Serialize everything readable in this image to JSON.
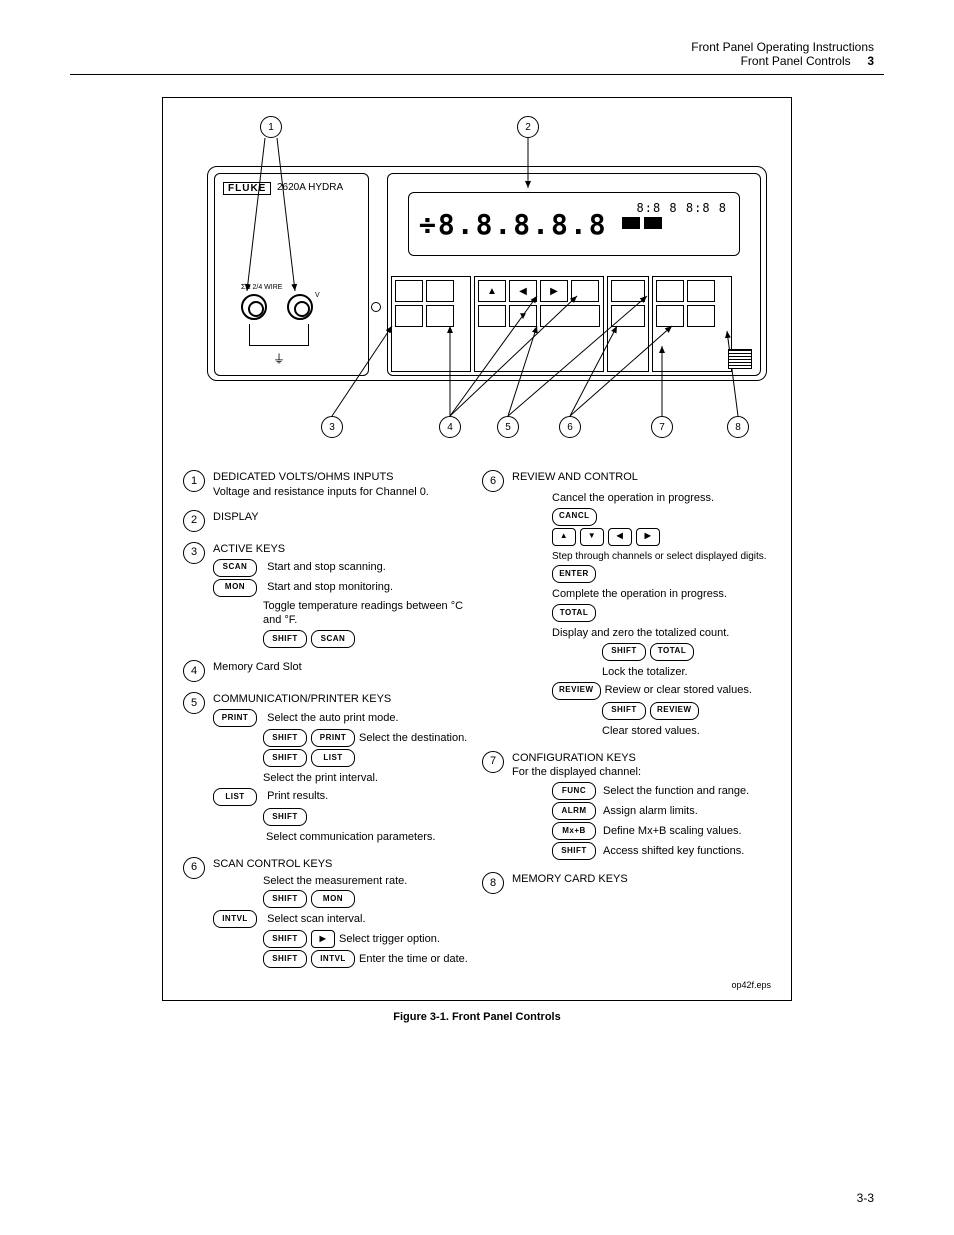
{
  "header": {
    "left": "",
    "right1": "Front Panel Operating Instructions",
    "right2": "Front Panel Controls",
    "chapter": "3"
  },
  "device": {
    "brand": "FLUKE",
    "model": "2620A  HYDRA",
    "sigma": "ΣΩ 2/4 WIRE",
    "vlabel": "V",
    "lcd_main": "÷8.8.8.8.8",
    "lcd_bars": true,
    "lcd_aux": "",
    "lcd_right": "8:8 8 8:8 8"
  },
  "bubbles": {
    "b1": "1",
    "b2": "2",
    "b3": "3",
    "b4": "4",
    "b5": "5",
    "b6": "6",
    "b7": "7",
    "b8": "8"
  },
  "legend": {
    "entries": {
      "1": {
        "title": "DEDICATED VOLTS/OHMS INPUTS",
        "sub": "Voltage and resistance inputs for Channel 0."
      },
      "2": {
        "title": "DISPLAY"
      },
      "3_title": "ACTIVE KEYS",
      "3": {
        "lines": [
          [
            "SCAN",
            "   Start and stop scanning."
          ],
          [
            "MON",
            "   Start and stop monitoring."
          ],
          "Toggle temperature readings between °C and °F.",
          [
            "SHIFT",
            "SCAN"
          ]
        ]
      },
      "4": {
        "title": "Memory Card Slot"
      },
      "5_title": "COMMUNICATION/PRINTER KEYS",
      "5": {
        "lines": [
          [
            "PRINT",
            "   Select the auto print mode."
          ],
          [
            "",
            "SHIFT",
            "PRINT",
            "Select the destination."
          ],
          [
            "",
            "SHIFT",
            "LIST",
            "Select the print interval."
          ],
          [
            "LIST",
            "   Print results."
          ],
          [
            "",
            "SHIFT",
            "  Select communication parameters."
          ]
        ]
      },
      "6_title": "SCAN CONTROL KEYS",
      "6": {
        "lines": [
          "Select the measurement rate.",
          [
            "",
            "SHIFT",
            "MON"
          ],
          [
            "INTVL",
            "   Select scan interval."
          ],
          [
            "",
            "SHIFT",
            "▶",
            "Select trigger option."
          ],
          [
            "",
            "SHIFT",
            "INTVL",
            "Enter the time or date."
          ]
        ]
      },
      "c6_title_right": "REVIEW AND CONTROL",
      "c6_right": {
        "before_cancl": "Cancel the operation in progress.",
        "after_cancl": [
          "CANCL"
        ],
        "arrows_desc": "Step through channels or select displayed digits.",
        "arrows": [
          "▲",
          "▼",
          "◀",
          "▶"
        ],
        "enter_desc": "Complete the operation in progress.",
        "enter": [
          "ENTER"
        ],
        "total_desc": "Display and zero the totalized count.",
        "total": [
          "TOTAL"
        ],
        "lock_desc": "Lock the totalizer.",
        "lock": [
          "SHIFT",
          "TOTAL"
        ],
        "review_desc": "Review or clear stored values.",
        "review": [
          "REVIEW"
        ],
        "clear_desc": "Clear stored values.",
        "clear": [
          "SHIFT",
          "REVIEW"
        ]
      },
      "7_title": "CONFIGURATION KEYS",
      "7": {
        "pre": "For the displayed channel:",
        "lines": [
          [
            "FUNC",
            "   Select the function and range."
          ],
          [
            "ALRM",
            "   Assign alarm limits."
          ],
          [
            "Mx+B",
            "   Define Mx+B scaling values."
          ],
          [
            "SHIFT",
            "    Access shifted key functions."
          ]
        ]
      },
      "8": "MEMORY CARD KEYS"
    }
  },
  "caption": "Figure 3-1. Front Panel Controls",
  "pagenum": "3-3",
  "figcode": "op42f.eps"
}
